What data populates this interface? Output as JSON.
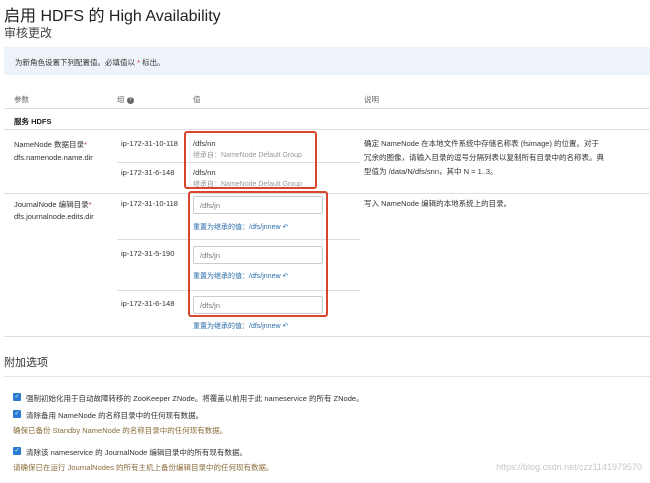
{
  "title": "启用 HDFS 的 High Availability",
  "step_title": "审核更改",
  "info": {
    "text": "为新角色设置下列配置值。必填值以",
    "req_mark": "*",
    "suffix": "标出。"
  },
  "table": {
    "headers": {
      "param": "参数",
      "group": "组",
      "value": "值",
      "desc": "说明"
    },
    "help_icon": "?",
    "section": "服务 HDFS"
  },
  "namenode": {
    "label": "NameNode 数据目录",
    "req": "*",
    "key": "dfs.namenode.name.dir",
    "rows": [
      {
        "host": "ip-172-31-10-118",
        "value": "/dfs/nn",
        "inherit": "继承自：NameNode Default Group"
      },
      {
        "host": "ip-172-31-6-148",
        "value": "/dfs/nn",
        "inherit": "继承自：NameNode Default Group"
      }
    ],
    "desc": "确定 NameNode 在本地文件系统中存储名称表 (fsimage) 的位置。对于冗余的图像，请输入目录的逗号分隔列表以复制所有目录中的名称表。典型值为 /data/N/dfs/snn，其中 N = 1..3。"
  },
  "journalnode": {
    "label": "JournalNode 编辑目录",
    "req": "*",
    "key": "dfs.journalnode.edits.dir",
    "rows": [
      {
        "host": "ip-172-31-10-118",
        "value": "/dfs/jn",
        "reset": "重置为继承的值：/dfs/jnnew"
      },
      {
        "host": "ip-172-31-5-190",
        "value": "/dfs/jn",
        "reset": "重置为继承的值：/dfs/jnnew"
      },
      {
        "host": "ip-172-31-6-148",
        "value": "/dfs/jn",
        "reset": "重置为继承的值：/dfs/jnnew"
      }
    ],
    "desc": "写入 NameNode 编辑的本地系统上的目录。"
  },
  "extra": {
    "title": "附加选项",
    "options": [
      {
        "label": "强制初始化用于自动故障转移的 ZooKeeper ZNode。将覆盖以前用于此 nameservice 的所有 ZNode。",
        "checked": true,
        "warning": ""
      },
      {
        "label": "清除备用 NameNode 的名称目录中的任何现有数据。",
        "checked": true,
        "warning": "确保已备份 Standby NameNode 的名称目录中的任何现有数据。"
      },
      {
        "label": "清除该 nameservice 的 JournalNode 编辑目录中的所有现有数据。",
        "checked": true,
        "warning": "请确保已在运行 JournalNodes 的所有主机上备份编辑目录中的任何现有数据。"
      }
    ]
  },
  "watermark": "https://blog.csdn.net/czz1141979570",
  "colors": {
    "highlight": "#d9452e",
    "link": "#2a6ca8",
    "checkbox": "#2a7ad1",
    "info_bg": "#eef3f9",
    "warning": "#8a6d3b"
  },
  "icons": {
    "reset": "↶",
    "check": "✓"
  }
}
